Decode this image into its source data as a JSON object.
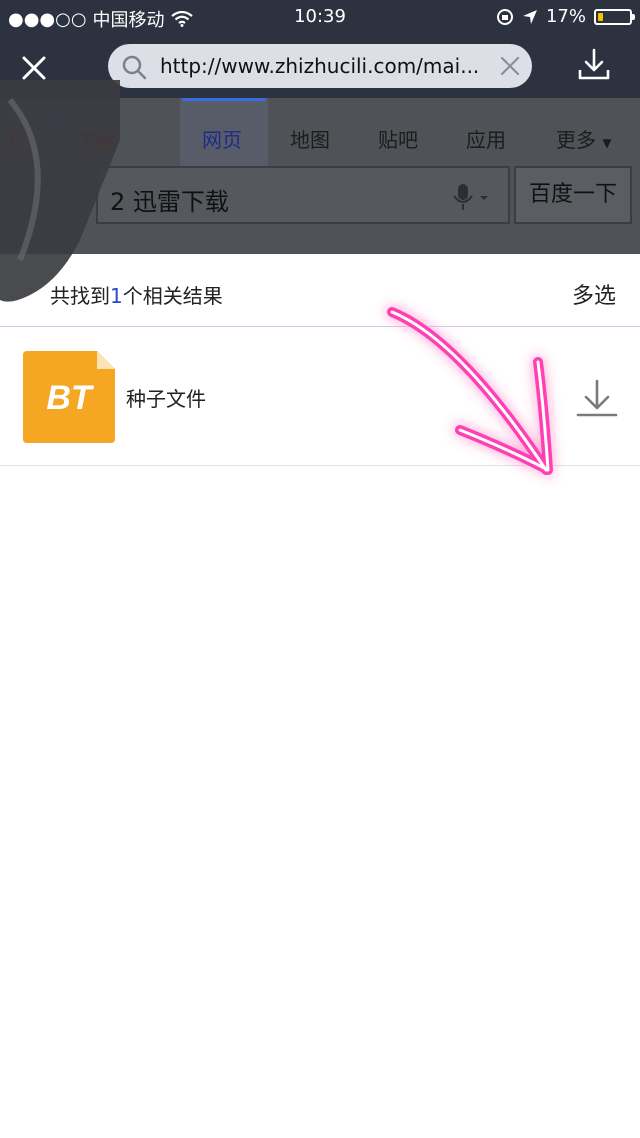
{
  "status_bar": {
    "signal": "●●●○○",
    "carrier": "中国移动",
    "time": "10:39",
    "battery": "17%"
  },
  "browser": {
    "url": "http://www.zhizhucili.com/mai...",
    "close_icon": "close-icon",
    "download_icon": "download-icon"
  },
  "background_page": {
    "logo": "E",
    "logo_tail": "下载",
    "tabs": [
      {
        "label": "网页",
        "active": true
      },
      {
        "label": "地图"
      },
      {
        "label": "贴吧"
      },
      {
        "label": "应用"
      },
      {
        "label": "更多"
      }
    ],
    "search_query": "2 迅雷下载",
    "search_button": "百度一下"
  },
  "results": {
    "count_prefix": "共找到",
    "count": "1",
    "count_suffix": "个相关结果",
    "multi_select": "多选",
    "items": [
      {
        "icon_text": "BT",
        "name": "种子文件"
      }
    ]
  },
  "colors": {
    "top_bar": "#2d3240",
    "bt_icon": "#f5a623",
    "arrow": "#ff3fb4"
  }
}
